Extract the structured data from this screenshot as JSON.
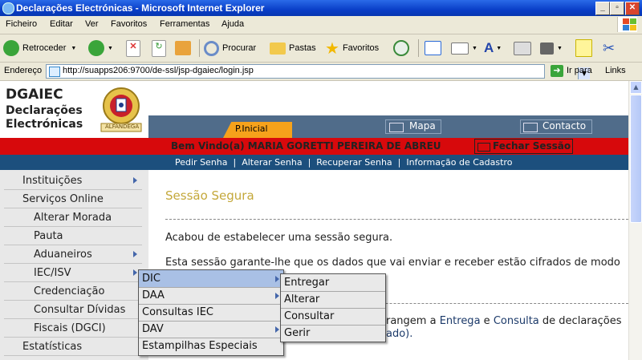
{
  "window": {
    "title": "Declarações Electrónicas - Microsoft Internet Explorer"
  },
  "menubar": [
    "Ficheiro",
    "Editar",
    "Ver",
    "Favoritos",
    "Ferramentas",
    "Ajuda"
  ],
  "toolbar": {
    "back": "Retroceder",
    "search": "Procurar",
    "folders": "Pastas",
    "favorites": "Favoritos"
  },
  "address": {
    "label": "Endereço",
    "url": "http://suapps206:9700/de-ssl/jsp-dgaiec/login.jsp",
    "go": "Ir para",
    "links": "Links"
  },
  "brand": {
    "org": "DGAIEC",
    "line1": "Declarações",
    "line2": "Electrónicas",
    "crest_text": "ALFANDEGA"
  },
  "header": {
    "home_tab": "P.Inicial",
    "map": "Mapa",
    "contact": "Contacto"
  },
  "welcome": {
    "text": "Bem Vindo(a) MARIA GORETTI PEREIRA DE ABREU",
    "logout": "Fechar Sessão"
  },
  "sublinks": "Pedir Senha  |  Alterar Senha  |  Recuperar Senha  |  Informação de Cadastro",
  "leftnav": [
    {
      "label": "Instituições",
      "arrow": true
    },
    {
      "label": "Serviços Online",
      "arrow": false
    },
    {
      "label": "Alterar Morada",
      "arrow": false
    },
    {
      "label": "Pauta",
      "arrow": false
    },
    {
      "label": "Aduaneiros",
      "arrow": true
    },
    {
      "label": "IEC/ISV",
      "arrow": true
    },
    {
      "label": "Credenciação",
      "arrow": false
    },
    {
      "label": "Consultar Dívidas",
      "arrow": false
    },
    {
      "label": "Fiscais (DGCI)",
      "arrow": false
    },
    {
      "label": "Estatísticas",
      "arrow": false
    }
  ],
  "content": {
    "title": "Sessão Segura",
    "p1": "Acabou de estabelecer uma sessão segura.",
    "p2": "Esta sessão garante-lhe que os dados que vai enviar e receber estão cifrados de modo",
    "p3a": "rangem a",
    "p3b": "Entrega",
    "p3c": "e",
    "p3d": "Consulta",
    "p3e": "de declarações",
    "p4": "ado)."
  },
  "menu1": [
    "DIC",
    "DAA",
    "Consultas IEC",
    "DAV",
    "Estampilhas Especiais"
  ],
  "menu2": [
    "Entregar",
    "Alterar",
    "Consultar",
    "Gerir"
  ]
}
